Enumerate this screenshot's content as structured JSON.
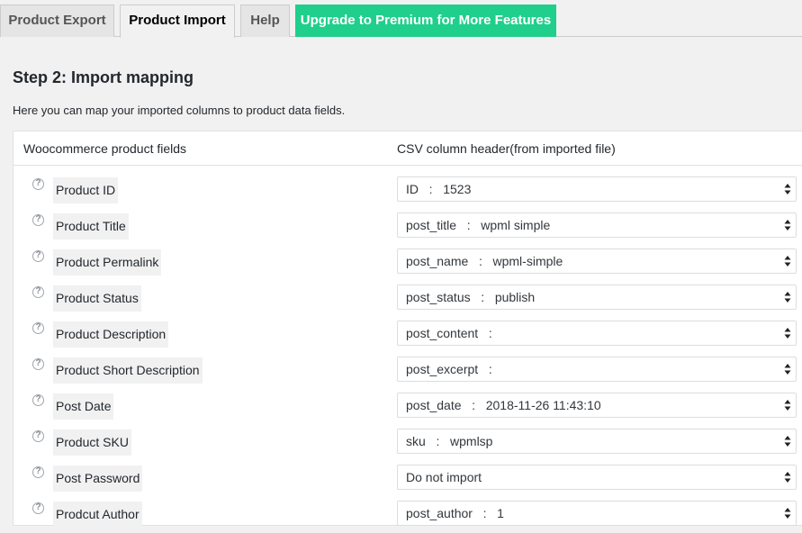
{
  "tabs": [
    {
      "label": "Product Export",
      "active": false
    },
    {
      "label": "Product Import",
      "active": true
    },
    {
      "label": "Help",
      "active": false
    },
    {
      "label": "Upgrade to Premium for More Features",
      "premium": true
    }
  ],
  "step_title": "Step 2: Import mapping",
  "description": "Here you can map your imported columns to product data fields.",
  "table": {
    "col_fields": "Woocommerce product fields",
    "col_csv": "CSV column header(from imported file)",
    "rows": [
      {
        "field": "Product ID",
        "selected": "ID   :   1523"
      },
      {
        "field": "Product Title",
        "selected": "post_title   :   wpml simple"
      },
      {
        "field": "Product Permalink",
        "selected": "post_name   :   wpml-simple"
      },
      {
        "field": "Product Status",
        "selected": "post_status   :   publish"
      },
      {
        "field": "Product Description",
        "selected": "post_content   :"
      },
      {
        "field": "Product Short Description",
        "selected": "post_excerpt   :"
      },
      {
        "field": "Post Date",
        "selected": "post_date   :   2018-11-26 11:43:10"
      },
      {
        "field": "Product SKU",
        "selected": "sku   :   wpmlsp"
      },
      {
        "field": "Post Password",
        "selected": "Do not import"
      },
      {
        "field": "Prodcut Author",
        "selected": "post_author   :   1"
      }
    ]
  },
  "icons": {
    "help": "question-circle-icon",
    "select_arrows": "up-down-arrows-icon"
  },
  "colors": {
    "premium_tab": "#1fcf8b",
    "background": "#f1f1f1"
  }
}
